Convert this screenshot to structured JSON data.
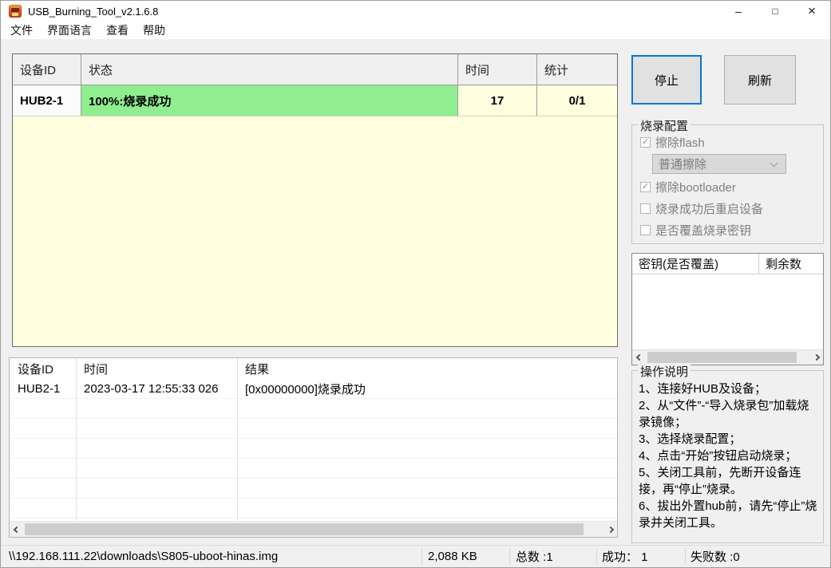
{
  "titlebar": {
    "title": "USB_Burning_Tool_v2.1.6.8",
    "minimize": "–",
    "maximize": "□",
    "close": "×"
  },
  "menu": {
    "items": [
      "文件",
      "界面语言",
      "查看",
      "帮助"
    ]
  },
  "device_table": {
    "headers": [
      "设备ID",
      "状态",
      "时间",
      "统计"
    ],
    "rows": [
      {
        "device_id": "HUB2-1",
        "status": "100%:烧录成功",
        "time": "17",
        "stats": "0/1"
      }
    ]
  },
  "actions": {
    "stop": "停止",
    "refresh": "刷新"
  },
  "burn_config": {
    "title": "烧录配置",
    "erase_flash": {
      "label": "擦除flash",
      "check": "✓"
    },
    "erase_mode": {
      "value": "普通擦除"
    },
    "erase_bootloader": {
      "label": "擦除bootloader",
      "check": "✓"
    },
    "reboot_after_success": {
      "label": "烧录成功后重启设备",
      "check": ""
    },
    "overwrite_key": {
      "label": "是否覆盖烧录密钥",
      "check": ""
    }
  },
  "key_table": {
    "headers": [
      "密钥(是否覆盖)",
      "剩余数"
    ]
  },
  "instructions": {
    "title": "操作说明",
    "lines": [
      "1、连接好HUB及设备；",
      "2、从“文件”-“导入烧录包”加载烧录镜像；",
      "3、选择烧录配置；",
      "4、点击“开始”按钮启动烧录；",
      "5、关闭工具前，先断开设备连接，再“停止”烧录。",
      "6、拔出外置hub前，请先“停止”烧录并关闭工具。"
    ]
  },
  "log_table": {
    "headers": [
      "设备ID",
      "时间",
      "结果"
    ],
    "rows": [
      {
        "device_id": "HUB2-1",
        "time": "2023-03-17 12:55:33 026",
        "result": "[0x00000000]烧录成功"
      }
    ]
  },
  "status_bar": {
    "file_path": "\\\\192.168.111.22\\downloads\\S805-uboot-hinas.img",
    "file_size": "2,088 KB",
    "total": "总数 :1",
    "success": "成功： 1",
    "failed": "失败数 :0"
  },
  "colors": {
    "accent_focus": "#0078d7",
    "status_success_green": "#90ee90",
    "table_idle_yellow": "#ffffdf"
  }
}
